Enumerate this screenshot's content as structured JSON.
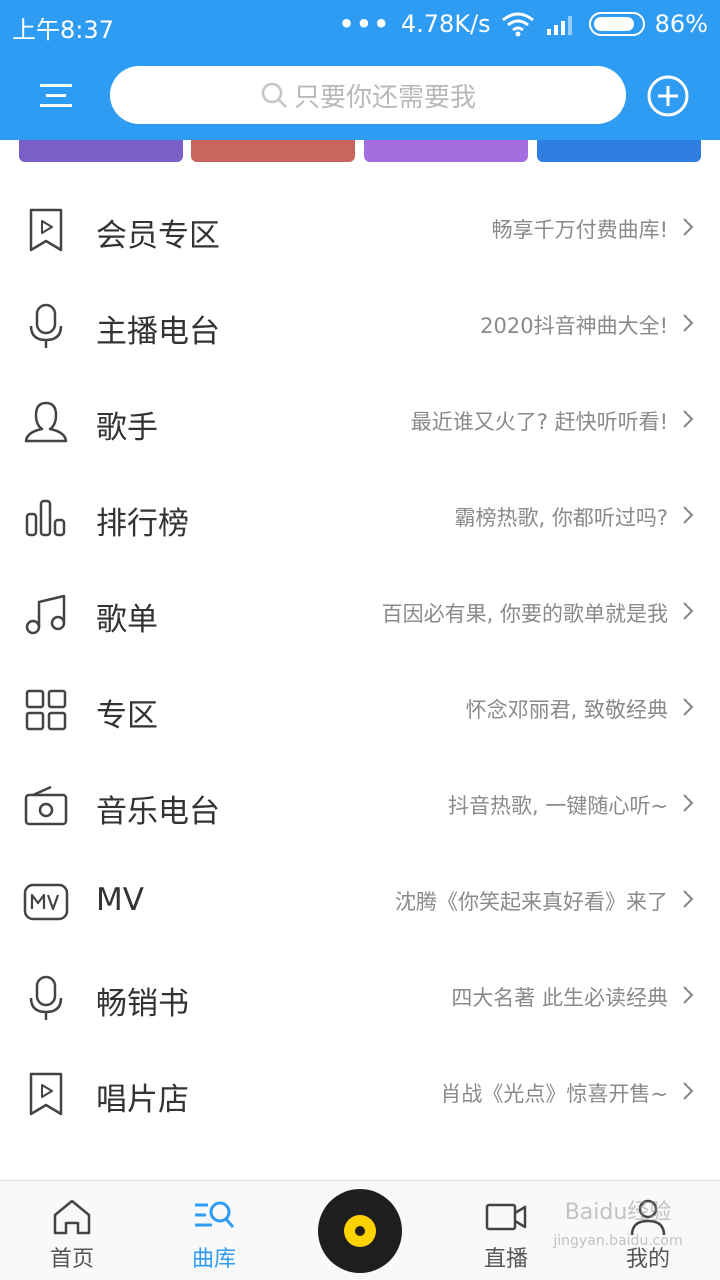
{
  "status_bar": {
    "time": "上午8:37",
    "dots": "•••",
    "speed": "4.78K/s",
    "battery": "86%",
    "icons": [
      "wifi-icon",
      "signal-icon",
      "battery-icon"
    ]
  },
  "header": {
    "search_placeholder": "只要你还需要我",
    "menu_icon": "menu-icon",
    "add_icon": "plus-circle-icon"
  },
  "colors": {
    "accent": "#2f9cf3",
    "text": "#333333",
    "subtext": "#8a8a8a",
    "banner_tiles": [
      "#7b5fc8",
      "#c8655e",
      "#a46de0",
      "#2f7fe0"
    ]
  },
  "list": [
    {
      "icon": "bookmark-play-icon",
      "label": "会员专区",
      "desc": "畅享千万付费曲库!"
    },
    {
      "icon": "microphone-icon",
      "label": "主播电台",
      "desc": "2020抖音神曲大全!"
    },
    {
      "icon": "person-icon",
      "label": "歌手",
      "desc": "最近谁又火了? 赶快听听看!"
    },
    {
      "icon": "bar-chart-icon",
      "label": "排行榜",
      "desc": "霸榜热歌, 你都听过吗?"
    },
    {
      "icon": "music-note-icon",
      "label": "歌单",
      "desc": "百因必有果, 你要的歌单就是我"
    },
    {
      "icon": "grid-icon",
      "label": "专区",
      "desc": "怀念邓丽君, 致敬经典"
    },
    {
      "icon": "radio-icon",
      "label": "音乐电台",
      "desc": "抖音热歌, 一键随心听~"
    },
    {
      "icon": "mv-icon",
      "label": "MV",
      "desc": "沈腾《你笑起来真好看》来了"
    },
    {
      "icon": "microphone-icon",
      "label": "畅销书",
      "desc": "四大名著 此生必读经典"
    },
    {
      "icon": "bookmark-play-icon",
      "label": "唱片店",
      "desc": "肖战《光点》惊喜开售~"
    }
  ],
  "bottom_nav": {
    "tabs": [
      {
        "label": "首页",
        "icon": "home-icon"
      },
      {
        "label": "曲库",
        "icon": "library-search-icon",
        "active": true
      },
      {
        "label": "直播",
        "icon": "video-camera-icon"
      },
      {
        "label": "我的",
        "icon": "user-icon"
      }
    ],
    "player_icon": "vinyl-disc-icon",
    "watermark": "Baidu经验",
    "watermark_sub": "jingyan.baidu.com"
  }
}
